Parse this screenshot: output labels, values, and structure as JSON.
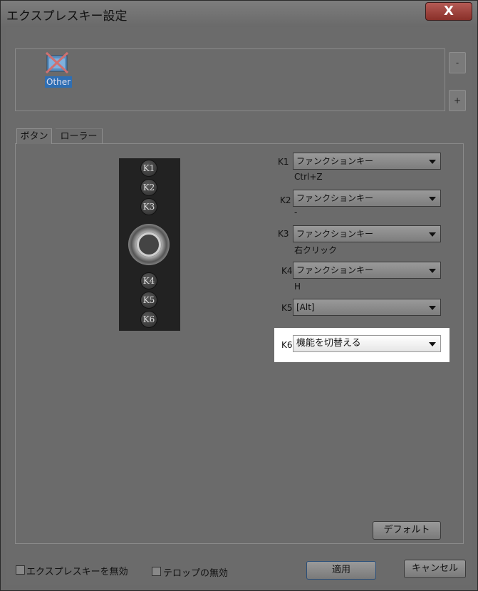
{
  "window": {
    "title": "エクスプレスキー設定",
    "close_label": "X"
  },
  "apps": {
    "selected_label": "Other",
    "minus_label": "-",
    "plus_label": "+"
  },
  "tabs": [
    {
      "label": "ボタン"
    },
    {
      "label": "ローラー"
    }
  ],
  "device": {
    "buttons": [
      "K1",
      "K2",
      "K3",
      "K4",
      "K5",
      "K6"
    ]
  },
  "keys": [
    {
      "label": "K1",
      "function": "ファンクションキー",
      "assigned": "Ctrl+Z"
    },
    {
      "label": "K2",
      "function": "ファンクションキー",
      "assigned": "-"
    },
    {
      "label": "K3",
      "function": "ファンクションキー",
      "assigned": "右クリック"
    },
    {
      "label": "K4",
      "function": "ファンクションキー",
      "assigned": "H"
    },
    {
      "label": "K5",
      "function": "[Alt]",
      "assigned": ""
    },
    {
      "label": "K6",
      "function": "機能を切替える",
      "assigned": ""
    }
  ],
  "buttons": {
    "default_label": "デフォルト",
    "apply_label": "適用",
    "cancel_label": "キャンセル"
  },
  "checkboxes": {
    "disable_expresskeys": "エクスプレスキーを無効",
    "disable_telop": "テロップの無効"
  },
  "colors": {
    "highlight": "#ffffff",
    "selection": "#2f6fb3",
    "close_button": "#a04640"
  }
}
